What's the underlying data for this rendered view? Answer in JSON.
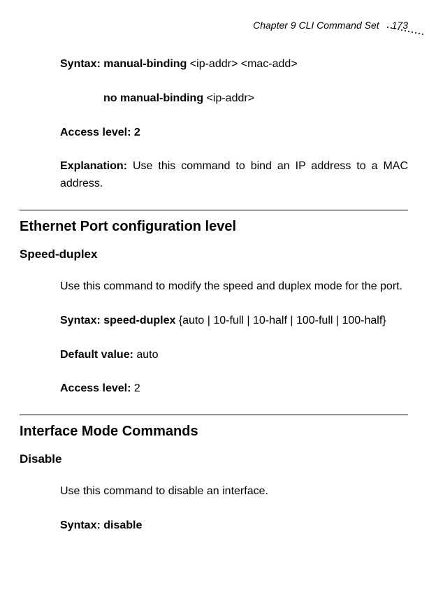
{
  "header": {
    "chapter": "Chapter 9 CLI Command Set",
    "page_number": "173"
  },
  "block1": {
    "syntax_label": "Syntax: manual-binding",
    "syntax_args": " <ip-addr>  <mac-add>",
    "no_form_label": "no manual-binding",
    "no_form_args": " <ip-addr>",
    "access_label": "Access level: 2",
    "explanation_label": "Explanation:",
    "explanation_text": " Use this command to bind an IP address to a MAC address."
  },
  "section1": {
    "title": "Ethernet Port configuration level",
    "subtitle": "Speed-duplex",
    "description": "Use this command to modify the speed and duplex mode for the port.",
    "syntax_label": "Syntax: speed-duplex",
    "syntax_args": " {auto | 10-full | 10-half | 100-full | 100-half}",
    "default_label": "Default value:",
    "default_value": " auto",
    "access_label": "Access level:",
    "access_value": " 2"
  },
  "section2": {
    "title": "Interface Mode Commands",
    "subtitle": "Disable",
    "description": "Use this command to disable an interface.",
    "syntax_label": "Syntax: disable"
  }
}
